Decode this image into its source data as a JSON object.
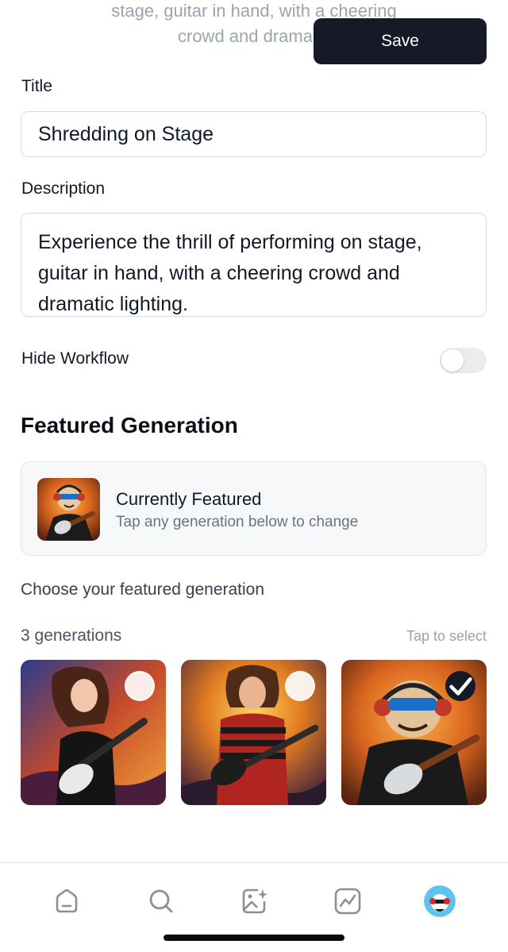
{
  "header": {
    "description_preview_line1": "stage, guitar in hand, with a cheering",
    "description_preview_line2": "crowd and dramatic",
    "save_label": "Save"
  },
  "form": {
    "title_label": "Title",
    "title_value": "Shredding on Stage",
    "description_label": "Description",
    "description_value": "Experience the thrill of performing on stage, guitar in hand, with a cheering crowd and dramatic lighting.",
    "hide_workflow_label": "Hide Workflow",
    "hide_workflow_on": false
  },
  "featured": {
    "section_title": "Featured Generation",
    "card_heading": "Currently Featured",
    "card_subtitle": "Tap any generation below to change",
    "choose_label": "Choose your featured generation",
    "count_label": "3 generations",
    "tap_hint": "Tap to select",
    "generations": [
      {
        "name": "woman-guitarist",
        "selected": false
      },
      {
        "name": "striped-shirt-guitarist",
        "selected": false
      },
      {
        "name": "sunglasses-emoji-guitarist",
        "selected": true
      }
    ]
  },
  "nav": {
    "items": [
      "home-icon",
      "search-icon",
      "create-image-icon",
      "activity-icon",
      "profile-avatar"
    ]
  },
  "colors": {
    "primary_dark": "#151a26",
    "muted_text": "#9ca3af",
    "card_bg": "#f7f8f9"
  }
}
